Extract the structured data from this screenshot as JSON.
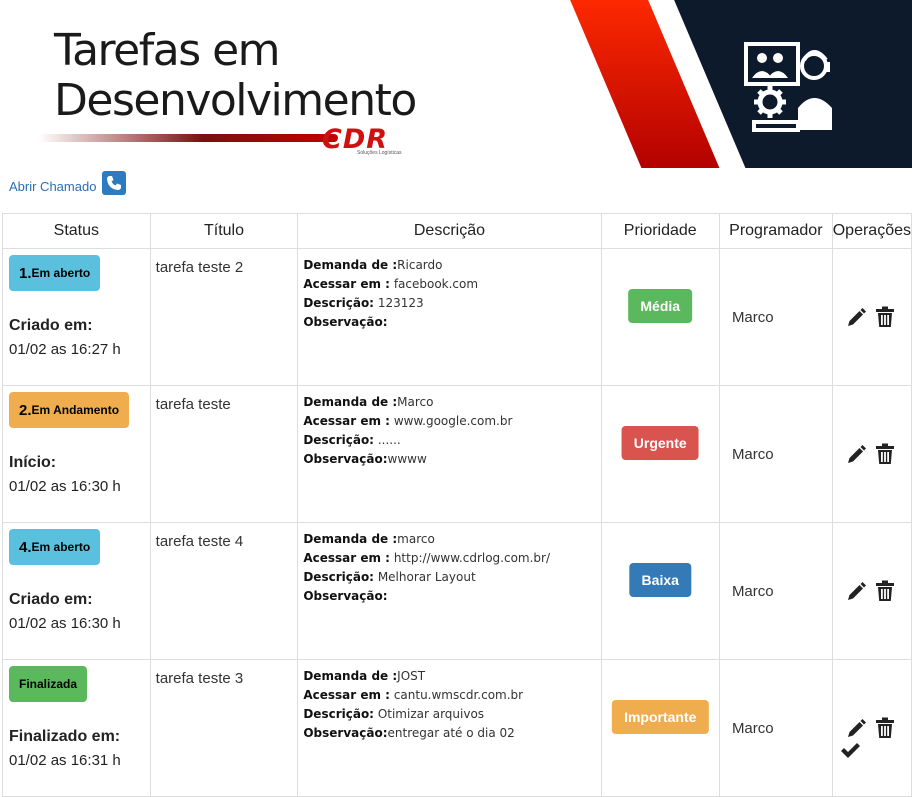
{
  "banner": {
    "title_line1": "Tarefas em",
    "title_line2": "Desenvolvimento",
    "brand_logo": "CDR",
    "brand_sub": "Soluções Logísticas",
    "accent_red": "#d01010",
    "dark_navy": "#0c1a2c",
    "illustration": "support-team-icon"
  },
  "actions": {
    "open_ticket_label": "Abrir Chamado",
    "phone_icon": "phone-icon"
  },
  "table": {
    "headers": {
      "status": "Status",
      "title": "Título",
      "description": "Descrição",
      "priority": "Prioridade",
      "programmer": "Programador",
      "operations": "Operações"
    },
    "field_labels": {
      "demand": "Demanda de :",
      "access": "Acessar em :",
      "description": "Descrição:",
      "observation": "Observação:"
    },
    "rows": [
      {
        "status_num": "1.",
        "status_text": "Em aberto",
        "status_color": "#5bc0de",
        "status_label": "Criado em:",
        "status_date": "01/02 as 16:27 h",
        "title": "tarefa teste 2",
        "demand": "Ricardo",
        "access": "facebook.com",
        "description": "123123",
        "observation": "",
        "priority": "Média",
        "priority_color": "#5cb85c",
        "programmer": "Marco"
      },
      {
        "status_num": "2.",
        "status_text": "Em Andamento",
        "status_color": "#f0ad4e",
        "status_label": "Início:",
        "status_date": "01/02 as 16:30 h",
        "title": "tarefa teste",
        "demand": "Marco",
        "access": "www.google.com.br",
        "description": "......",
        "observation": "wwww",
        "priority": "Urgente",
        "priority_color": "#d9534f",
        "programmer": "Marco"
      },
      {
        "status_num": "4.",
        "status_text": "Em aberto",
        "status_color": "#5bc0de",
        "status_label": "Criado em:",
        "status_date": "01/02 as 16:30 h",
        "title": "tarefa teste 4",
        "demand": "marco",
        "access": "http://www.cdrlog.com.br/",
        "description": "Melhorar Layout",
        "observation": "",
        "priority": "Baixa",
        "priority_color": "#337ab7",
        "programmer": "Marco"
      },
      {
        "status_num": "",
        "status_text": "Finalizada",
        "status_color": "#5cb85c",
        "status_label": "Finalizado em:",
        "status_date": "01/02 as 16:31 h",
        "title": "tarefa teste 3",
        "demand": "JOST",
        "access": "cantu.wmscdr.com.br",
        "description": "Otimizar arquivos",
        "observation": "entregar até o dia 02",
        "priority": "Importante",
        "priority_color": "#f0ad4e",
        "programmer": "Marco"
      }
    ]
  },
  "icons": {
    "edit": "pencil-icon",
    "delete": "trash-icon",
    "complete": "check-icon"
  }
}
